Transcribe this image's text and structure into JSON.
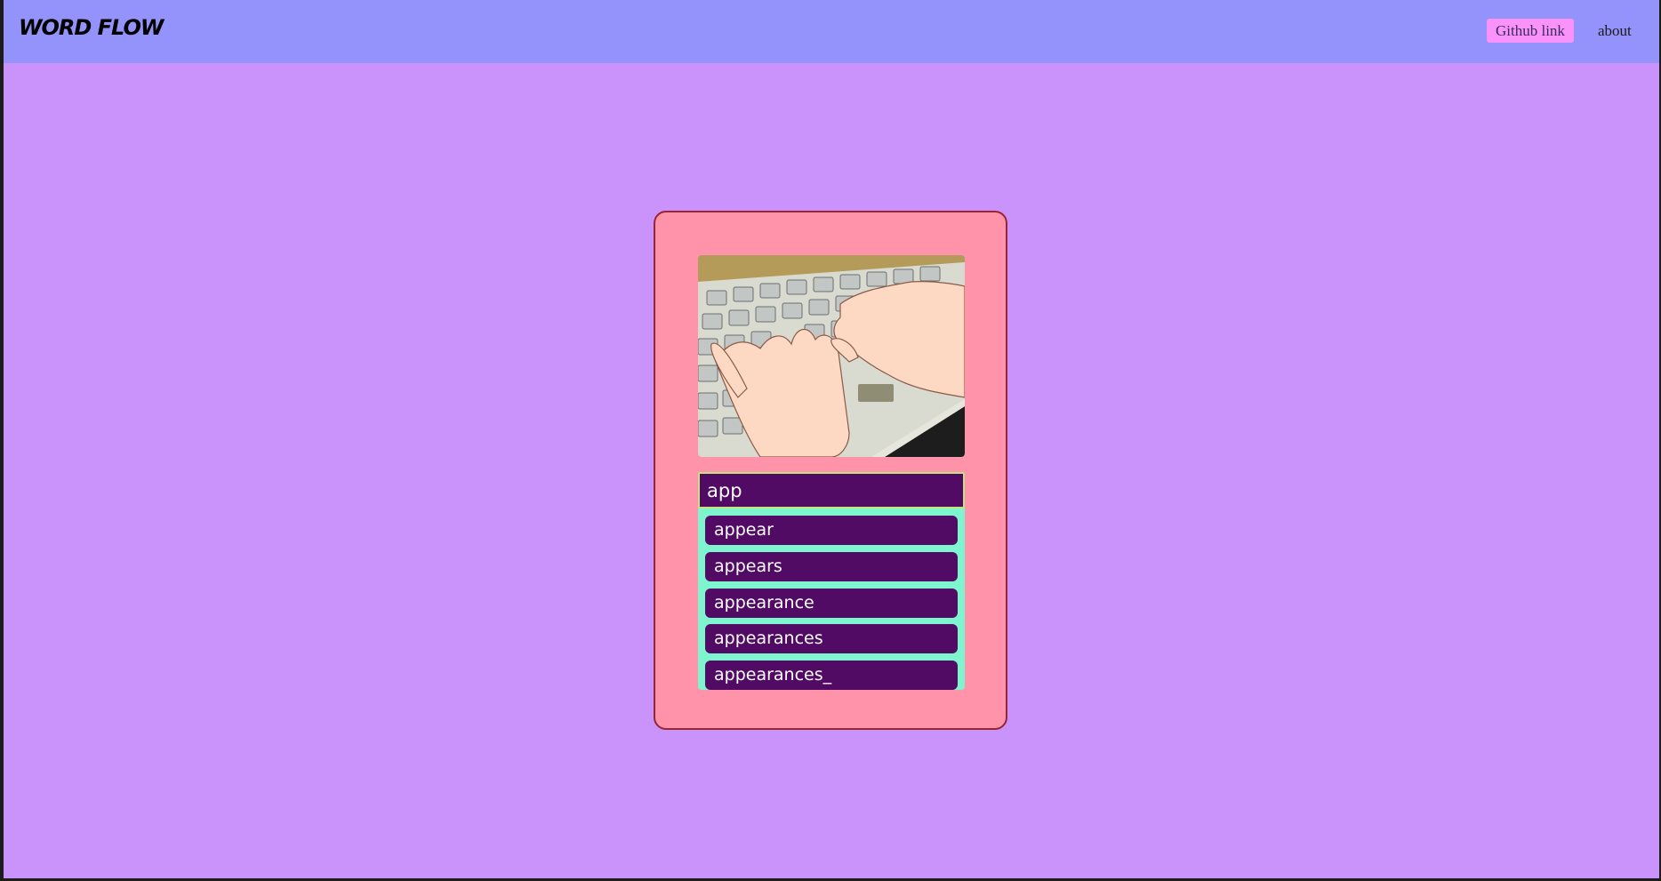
{
  "app": {
    "title": "WORD FLOW"
  },
  "nav": {
    "github_label": "Github link",
    "about_label": "about"
  },
  "search": {
    "value": "app"
  },
  "suggestions": [
    "appear",
    "appears",
    "appearance",
    "appearances",
    "appearances_"
  ],
  "colors": {
    "navbar": "#9493fb",
    "page_bg": "#c993fb",
    "card_bg": "#fe93a9",
    "card_border": "#9a2530",
    "input_bg": "#520b65",
    "suggestions_bg": "#7ef5cf",
    "github_button": "#f993fb"
  }
}
